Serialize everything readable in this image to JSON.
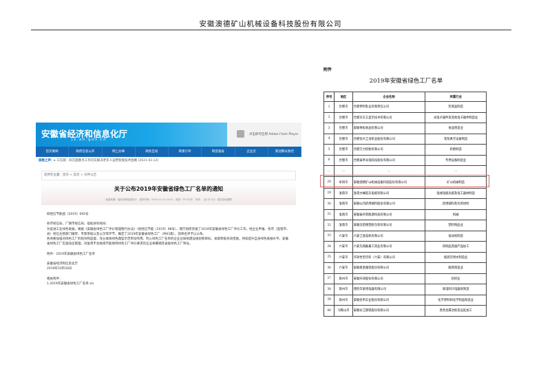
{
  "page_header": "安徽澳德矿山机械设备科技股份有限公司",
  "screenshot": {
    "site_title": "安徽省经济和信息化厅",
    "site_url": "jx.ah.gov.cn",
    "flash_notice": "点击即可启用 Adobe Flash Player",
    "nav": [
      "首页要闻",
      "政府信息公开",
      "网上办事",
      "政民互动",
      "政策引导",
      "制造强省",
      "企业云",
      "新冠肺炎防控"
    ],
    "ticker_label": "部委之声：",
    "ticker_text": "▸ 工信部：四方面重点工作切实解决老年人运用智能技术困难 [2021-02-22]",
    "breadcrumb": "您所在位置：首页 > 首页 > 文件公告",
    "article_title": "关于公布2019年安徽省绿色工厂名单的通知",
    "meta": "信息来源：省经济和信息化厅　发布时间：2019-11-01 10:41　浏览：91724次　字体：【大 中 小】　双击自动滚屏",
    "doc_no": "皖经信节能函〔2019〕692号",
    "salutation": "各市经信局，广德市经信局、宿松县科经局：",
    "para1": "为促进工业绿色发展，根据《安徽省绿色工厂评价管理暂行办法》（皖经信节能〔2019〕98号），我厅组织开展了2019年安徽省绿色工厂评价工作，经企业申报、各市（直管市、县）经信主管部门推荐、专家审核以及公示等环节，确定了2019年安徽省绿色工厂（共63家），现将名单予以公布。",
    "para2": "各地要加强对绿色工厂的指导和监督，充分发挥绿色典型示范带动作用。列入绿色工厂名单的企业应按照建设规划和目标，采取积极有效措施，持续提升自身绿色发展水平。安徽省绿色工厂实施动态管理，对复审不合格或不能保持绿色工厂评价要求的企业将撤销其省级绿色工厂称号。",
    "attachment": "附件：2019年安徽省绿色工厂名单",
    "signer": "安徽省经济和信息化厅",
    "date": "2019年10月30日",
    "related_label": "相关附件：",
    "related_file": "1.2019年安徽省绿色工厂名单.xls"
  },
  "attachment_label": "附件",
  "table_title": "2019年安徽省绿色工厂名单",
  "table": {
    "headers": [
      "序号",
      "地区",
      "企业名称",
      "所属行业"
    ],
    "rows": [
      [
        "1",
        "合肥市",
        "合肥伊利乳业有限责任公司",
        "乳制品制造"
      ],
      [
        "2",
        "合肥市",
        "合肥京东方显示技术有限公司",
        "光电子器件及其他电子器件制造业"
      ],
      [
        "3",
        "合肥市",
        "安徽青松食品有限公司",
        "食品制造业"
      ],
      [
        "4",
        "合肥市",
        "合肥恒大江海泵业股份有限公司",
        "泵及真空设备制造"
      ],
      [
        "5",
        "合肥市",
        "合肥万力轮胎有限公司",
        "轮胎制造"
      ],
      [
        "6",
        "合肥市",
        "合肥泰禾光电科技股份有限公司",
        "专用设备制造业"
      ],
      [
        "…",
        "…",
        "…",
        "…"
      ],
      [
        "28",
        "阜阳市",
        "安徽澳德矿山机械设备科技股份有限公司",
        "矿山机械制造"
      ],
      [
        "29",
        "淮南市",
        "淮南文峰航天电缆有限公司",
        "电线电缆光缆及电工器材制造"
      ],
      [
        "30",
        "淮南市",
        "安徽山河药用辅料股份有限公司",
        "药用辅料及包装材料"
      ],
      [
        "31",
        "淮南市",
        "安徽泰升新能源科技有限公司",
        "机械"
      ],
      [
        "32",
        "淮南市",
        "安徽浩诺德塑胶包装有限公司",
        "塑料制品业"
      ],
      [
        "33",
        "六安市",
        "六安江淮电机有限公司",
        "电动机制造"
      ],
      [
        "34",
        "六安市",
        "六安先翔畜禽工贸业有限公司",
        "肉制品及副产品加工"
      ],
      [
        "35",
        "六安市",
        "华润怡宝饮料（六安）有限公司",
        "瓶装饮用水制造业"
      ],
      [
        "36",
        "六安市",
        "安徽星星服装股份有限公司",
        "服装制造业"
      ],
      [
        "37",
        "滁州市",
        "安徽开润股份有限公司",
        "纺织业"
      ],
      [
        "38",
        "滁州市",
        "博西华家用电器有限公司",
        "家电制冷电器具制造"
      ],
      [
        "39",
        "滁州市",
        "安徽金禾实业股份有限公司",
        "化学原料和化学制品制造业"
      ],
      [
        "40",
        "马鞍山市",
        "安徽长江钢铁股份有限公司",
        "黑色金属冶炼及压延加工"
      ]
    ]
  }
}
